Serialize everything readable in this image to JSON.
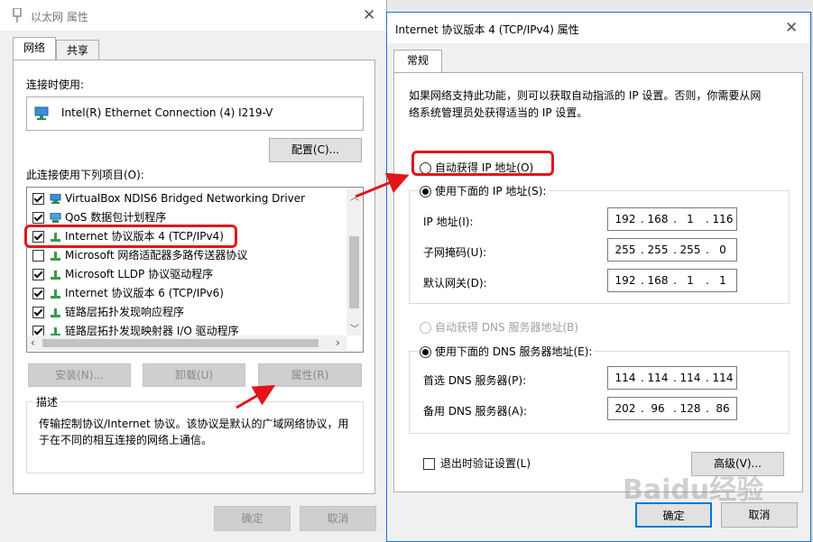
{
  "left_dialog": {
    "title": "以太网 属性",
    "tabs": [
      "网络",
      "共享"
    ],
    "connect_using_label": "连接时使用:",
    "adapter_name": "Intel(R) Ethernet Connection (4) I219-V",
    "configure_button": "配置(C)...",
    "items_label": "此连接使用下列项目(O):",
    "items": [
      {
        "label": "VirtualBox NDIS6 Bridged Networking Driver",
        "checked": true,
        "icon": "monitor-network-icon"
      },
      {
        "label": "QoS 数据包计划程序",
        "checked": true,
        "icon": "qos-icon"
      },
      {
        "label": "Internet 协议版本 4 (TCP/IPv4)",
        "checked": true,
        "icon": "protocol-icon"
      },
      {
        "label": "Microsoft 网络适配器多路传送器协议",
        "checked": false,
        "icon": "protocol-icon"
      },
      {
        "label": "Microsoft LLDP 协议驱动程序",
        "checked": true,
        "icon": "protocol-icon"
      },
      {
        "label": "Internet 协议版本 6 (TCP/IPv6)",
        "checked": true,
        "icon": "protocol-icon"
      },
      {
        "label": "链路层拓扑发现响应程序",
        "checked": true,
        "icon": "protocol-icon"
      },
      {
        "label": "链路层拓扑发现映射器 I/O 驱动程序",
        "checked": true,
        "icon": "protocol-icon"
      }
    ],
    "install_button": "安装(N)...",
    "uninstall_button": "卸载(U)",
    "properties_button": "属性(R)",
    "description_label": "描述",
    "description_text_line1": "传输控制协议/Internet 协议。该协议是默认的广域网络协议，用",
    "description_text_line2": "于在不同的相互连接的网络上通信。",
    "ok_button": "确定",
    "cancel_button": "取消"
  },
  "right_dialog": {
    "title": "Internet 协议版本 4 (TCP/IPv4) 属性",
    "tab": "常规",
    "intro_line1": "如果网络支持此功能，则可以获取自动指派的 IP 设置。否则，你需要从网",
    "intro_line2": "络系统管理员处获得适当的 IP 设置。",
    "auto_ip_label": "自动获得 IP 地址(O)",
    "manual_ip_label": "使用下面的 IP 地址(S):",
    "ip_label": "IP 地址(I):",
    "ip_value": [
      "192",
      "168",
      "1",
      "116"
    ],
    "subnet_label": "子网掩码(U):",
    "subnet_value": [
      "255",
      "255",
      "255",
      "0"
    ],
    "gateway_label": "默认网关(D):",
    "gateway_value": [
      "192",
      "168",
      "1",
      "1"
    ],
    "auto_dns_label": "自动获得 DNS 服务器地址(B)",
    "manual_dns_label": "使用下面的 DNS 服务器地址(E):",
    "preferred_dns_label": "首选 DNS 服务器(P):",
    "preferred_dns_value": [
      "114",
      "114",
      "114",
      "114"
    ],
    "alternate_dns_label": "备用 DNS 服务器(A):",
    "alternate_dns_value": [
      "202",
      "96",
      "128",
      "86"
    ],
    "validate_label": "退出时验证设置(L)",
    "advanced_button": "高级(V)...",
    "ok_button": "确定",
    "cancel_button": "取消"
  },
  "watermark": "Baidu经验",
  "colors": {
    "highlight_red": "#e3151a",
    "accent_blue": "#1e6fd6"
  }
}
